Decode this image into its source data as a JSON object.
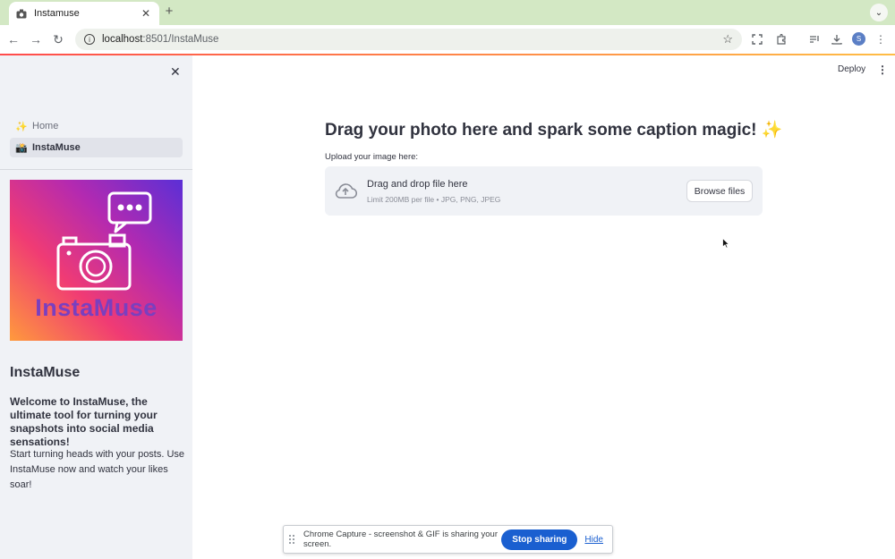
{
  "browser": {
    "tab_title": "Instamuse",
    "tab_close": "✕",
    "new_tab": "+",
    "url_host": "localhost",
    "url_path": ":8501/InstaMuse",
    "profile_initial": "S"
  },
  "app": {
    "deploy_label": "Deploy"
  },
  "sidebar": {
    "nav": [
      {
        "icon": "✨",
        "label": "Home"
      },
      {
        "icon": "📸",
        "label": "InstaMuse"
      }
    ],
    "logo_text": "InstaMuse",
    "title": "InstaMuse",
    "intro": "Welcome to InstaMuse, the ultimate tool for turning your snapshots into social media sensations!",
    "body": "Start turning heads with your posts. Use InstaMuse now and watch your likes soar!"
  },
  "main": {
    "heading": "Drag your photo here and spark some caption magic! ✨",
    "upload_label": "Upload your image here:",
    "dropzone": {
      "title": "Drag and drop file here",
      "subtitle": "Limit 200MB per file • JPG, PNG, JPEG",
      "browse_label": "Browse files"
    }
  },
  "share_bar": {
    "message": "Chrome Capture - screenshot & GIF is sharing your screen.",
    "stop_label": "Stop sharing",
    "hide_label": "Hide"
  },
  "colors": {
    "accent_red": "#ff4b4b",
    "sidebar_bg": "#f0f2f6",
    "share_blue": "#1a5fd0"
  }
}
